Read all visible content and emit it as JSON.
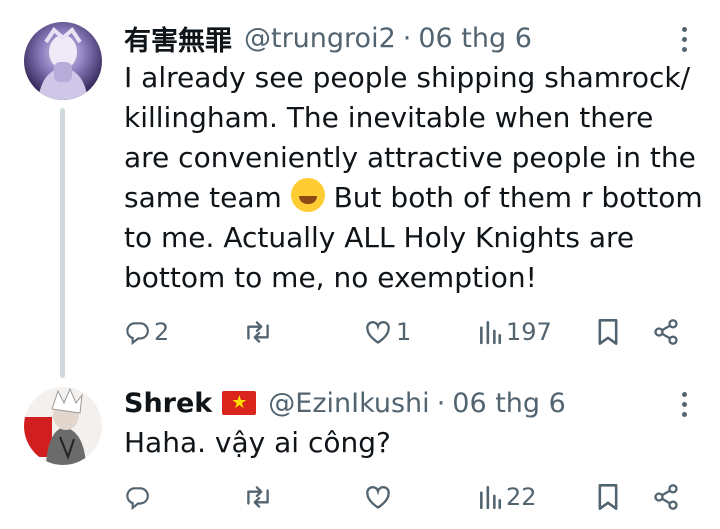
{
  "tweets": [
    {
      "name": "有害無罪",
      "handle": "@trungroi2",
      "separator": "·",
      "date": "06 thg 6",
      "text_before_emoji": "I already see people shipping shamrock/ killingham. The inevitable when there are conveniently attractive people in the same team ",
      "text_after_emoji": " But both of them r bottom to me. Actually ALL Holy Knights are bottom to me, no exemption!",
      "emoji": "rolling-on-floor-laughing",
      "replies": "2",
      "retweets": "",
      "likes": "1",
      "views": "197"
    },
    {
      "name": "Shrek",
      "flag": "vietnam-flag",
      "flag_star": "★",
      "handle": "@EzinIkushi",
      "separator": "·",
      "date": "06 thg 6",
      "text": "Haha. vậy ai công?",
      "replies": "",
      "retweets": "",
      "likes": "",
      "views": "22"
    }
  ],
  "colors": {
    "text": "#0f1419",
    "secondary": "#536471",
    "thread_line": "#cfd9de"
  }
}
